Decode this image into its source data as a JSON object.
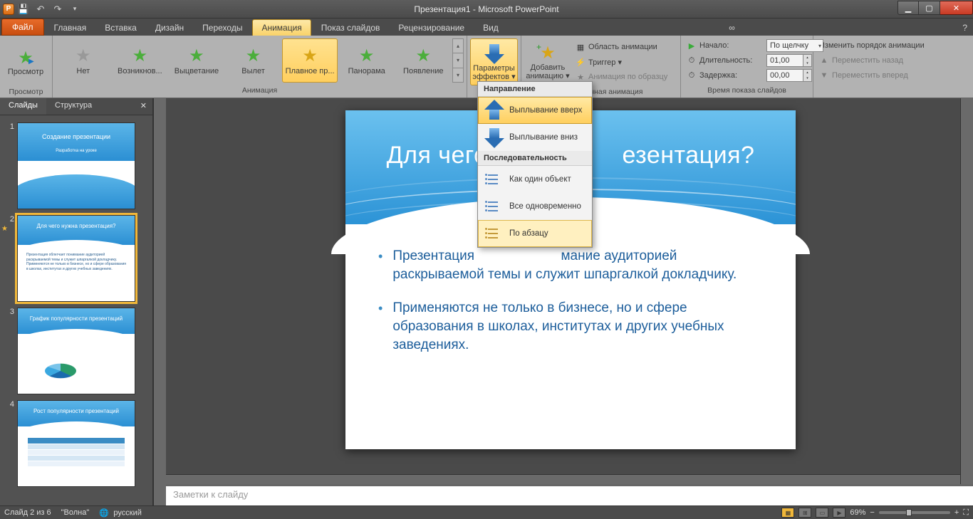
{
  "title": "Презентация1 - Microsoft PowerPoint",
  "app_letter": "P",
  "file_tab": "Файл",
  "tabs": [
    "Главная",
    "Вставка",
    "Дизайн",
    "Переходы",
    "Анимация",
    "Показ слайдов",
    "Рецензирование",
    "Вид"
  ],
  "active_tab_index": 4,
  "ribbon": {
    "preview_btn": "Просмотр",
    "preview_group": "Просмотр",
    "anim_items": [
      "Нет",
      "Возникнов...",
      "Выцветание",
      "Вылет",
      "Плавное пр...",
      "Панорама",
      "Появление"
    ],
    "anim_selected_index": 4,
    "anim_group": "Анимация",
    "effect_options": "Параметры\nэффектов ▾",
    "add_anim": "Добавить\nанимацию ▾",
    "anim_pane": "Область анимации",
    "trigger": "Триггер ▾",
    "anim_painter": "Анимация по образцу",
    "ext_anim_group": "Расширенная анимация",
    "start_label": "Начало:",
    "start_value": "По щелчку",
    "duration_label": "Длительность:",
    "duration_value": "01,00",
    "delay_label": "Задержка:",
    "delay_value": "00,00",
    "timing_group": "Время показа слайдов",
    "reorder_header": "Изменить порядок анимации",
    "move_earlier": "Переместить назад",
    "move_later": "Переместить вперед"
  },
  "effect_menu": {
    "section1": "Направление",
    "item1": "Выплывание вверх",
    "item2": "Выплывание вниз",
    "section2": "Последовательность",
    "item3": "Как один объект",
    "item4": "Все одновременно",
    "item5": "По абзацу"
  },
  "side": {
    "tab_slides": "Слайды",
    "tab_outline": "Структура"
  },
  "thumbs": [
    {
      "title": "Создание презентации",
      "sub": "Разработка на уроке"
    },
    {
      "title": "Для чего нужна презентация?",
      "body": "Презентация облегчает понимание аудиторией раскрываемой темы и служит шпаргалкой докладчику. Применяются не только в бизнесе, но и сфере образования в школах, институтах и других учебных заведениях."
    },
    {
      "title": "График популярности презентаций",
      "body": "pie"
    },
    {
      "title": "Рост популярности презентаций",
      "body": "table"
    }
  ],
  "slide": {
    "title": "Для чего нужна презентация?",
    "title_visible": "Для чего                   езентация?",
    "bullets": [
      "Презентация                       мание аудиторией раскрываемой темы и служит шпаргалкой докладчику.",
      "Применяются не только в бизнесе, но и сфере образования в школах, институтах и других учебных заведениях."
    ]
  },
  "notes_placeholder": "Заметки к слайду",
  "status": {
    "slide_info": "Слайд 2 из 6",
    "theme": "\"Волна\"",
    "lang": "русский",
    "zoom": "69%"
  }
}
